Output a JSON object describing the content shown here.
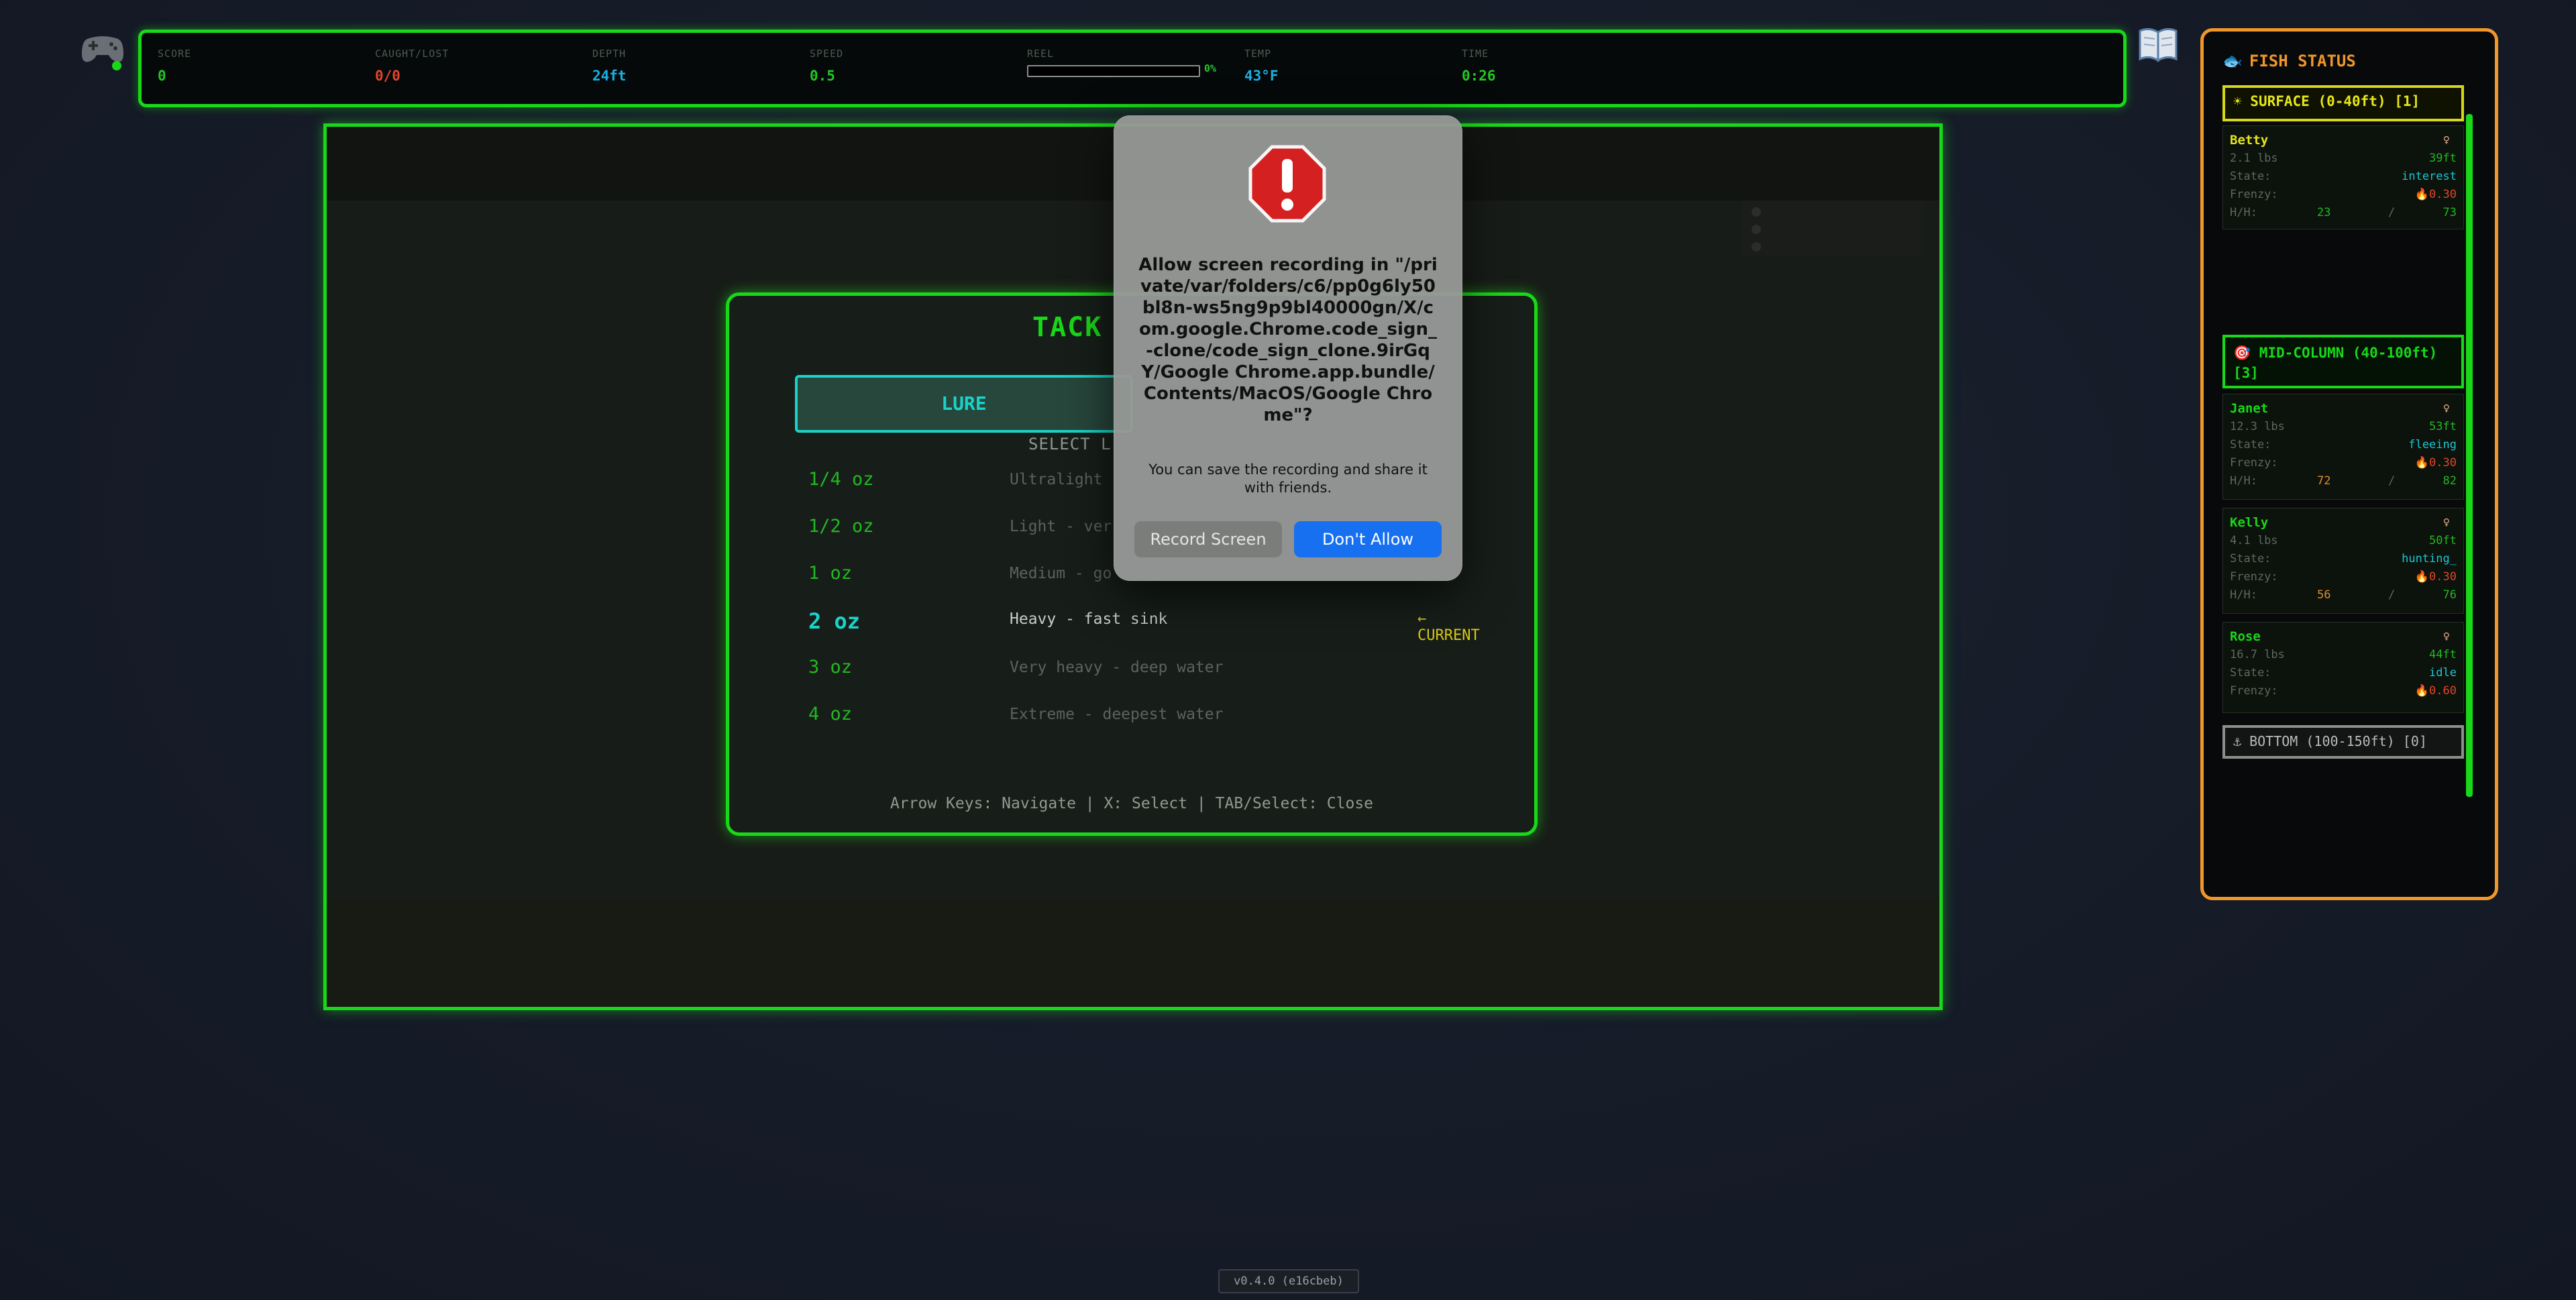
{
  "hud": {
    "stats": [
      {
        "label": "SCORE",
        "value": "0",
        "color": "#22c822"
      },
      {
        "label": "CAUGHT/LOST",
        "value": "0/0",
        "color": "#e2442a"
      },
      {
        "label": "DEPTH",
        "value": "24ft",
        "color": "#1ab0e0"
      },
      {
        "label": "SPEED",
        "value": "0.5",
        "color": "#22c822"
      },
      {
        "label": "REEL",
        "value": "0%",
        "color": "#22c822",
        "progress": 0
      },
      {
        "label": "TEMP",
        "value": "43°F",
        "color": "#1ab0e0"
      },
      {
        "label": "TIME",
        "value": "0:26",
        "color": "#22c822"
      }
    ],
    "left_icon": "gamepad-icon",
    "right_icon": "book-icon"
  },
  "tackle_box": {
    "title": "TACK",
    "tab_label": "LURE",
    "select_label": "SELECT L",
    "options": [
      {
        "weight": "1/4 oz",
        "desc": "Ultralight"
      },
      {
        "weight": "1/2 oz",
        "desc": "Light - ver"
      },
      {
        "weight": "1 oz",
        "desc": "Medium - go"
      },
      {
        "weight": "2 oz",
        "desc": "Heavy - fast sink",
        "current": true
      },
      {
        "weight": "3 oz",
        "desc": "Very heavy - deep water"
      },
      {
        "weight": "4 oz",
        "desc": "Extreme - deepest water"
      }
    ],
    "current_tag": "← CURRENT",
    "help": "Arrow Keys: Navigate | X: Select | TAB/Select: Close"
  },
  "dialog": {
    "icon": "warning-icon",
    "title": "Allow screen recording in \"/private/var/folders/c6/pp0g6ly50bl8n-ws5ng9p9bl40000gn/X/com.google.Chrome.code_sign_-clone/code_sign_clone.9irGqY/Google Chrome.app.bundle/Contents/MacOS/Google Chrome\"?",
    "message": "You can save the recording and share it with friends.",
    "record_label": "Record Screen",
    "deny_label": "Don't Allow"
  },
  "fish_status": {
    "title": "FISH STATUS",
    "zones": {
      "surface": "SURFACE (0-40ft) [1]",
      "mid": "MID-COLUMN (40-100ft) [3]",
      "bottom": "BOTTOM (100-150ft) [0]"
    },
    "fish": [
      {
        "name": "Betty",
        "sex": "♀",
        "weight": "2.1 lbs",
        "depth": "39ft",
        "state": "interest",
        "frenzy": "0.30",
        "hunger": "23",
        "health": "73"
      },
      {
        "name": "Janet",
        "sex": "♀",
        "weight": "12.3 lbs",
        "depth": "53ft",
        "state": "fleeing",
        "frenzy": "0.30",
        "hunger": "72",
        "health": "82"
      },
      {
        "name": "Kelly",
        "sex": "♀",
        "weight": "4.1 lbs",
        "depth": "50ft",
        "state": "hunting_",
        "frenzy": "0.30",
        "hunger": "56",
        "health": "76"
      },
      {
        "name": "Rose",
        "sex": "♀",
        "weight": "16.7 lbs",
        "depth": "44ft",
        "state": "idle",
        "frenzy": "0.60",
        "hunger": "",
        "health": ""
      }
    ],
    "labels": {
      "state": "State:",
      "frenzy": "Frenzy:",
      "hh": "H/H:",
      "slash": "/",
      "fire": "🔥"
    }
  },
  "version": "v0.4.0 (e16cbeb)"
}
